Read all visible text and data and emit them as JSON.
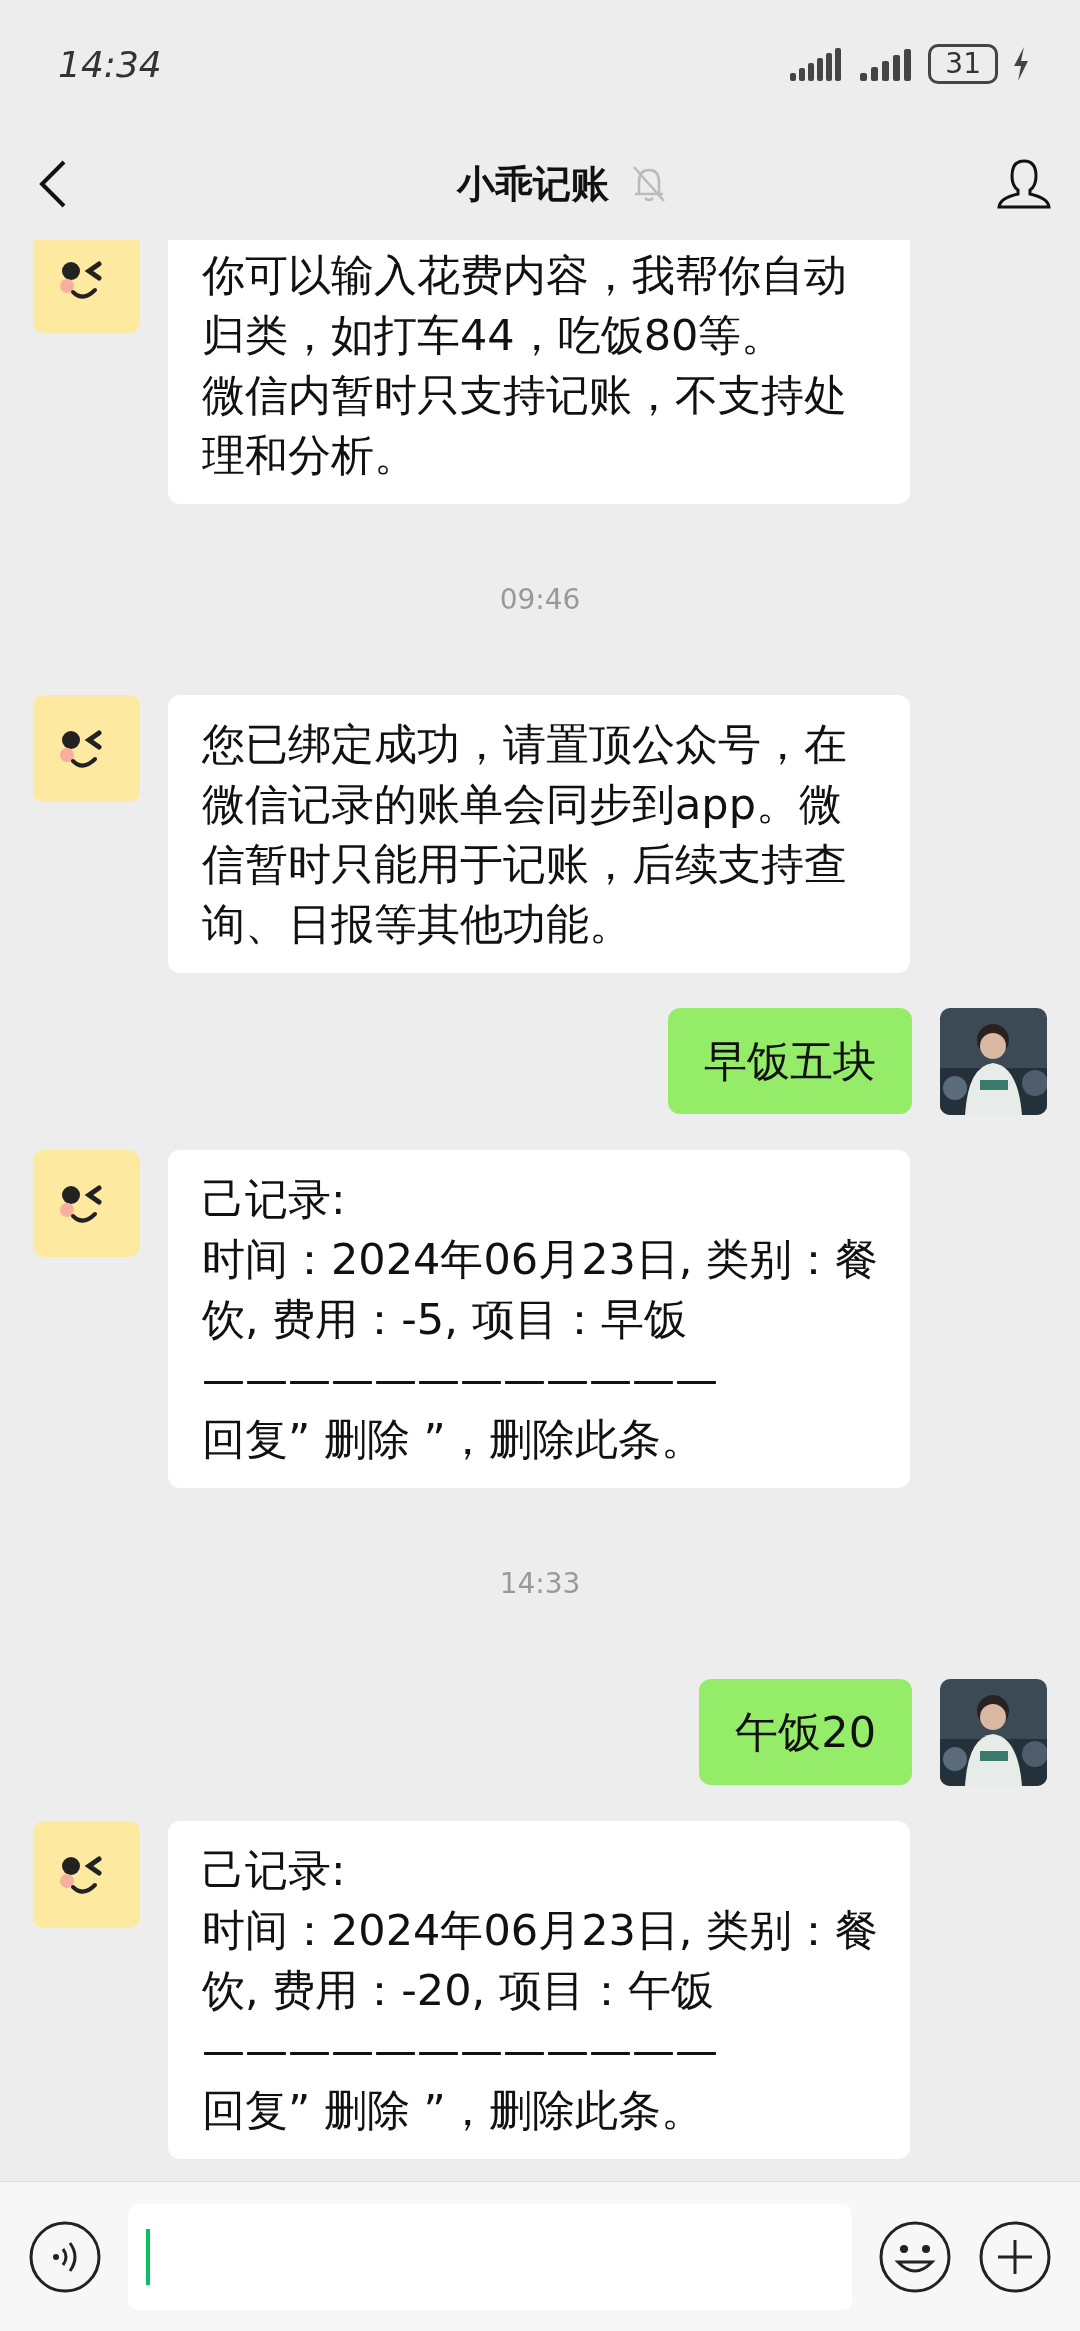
{
  "status_bar": {
    "time": "14:34",
    "battery": "31"
  },
  "header": {
    "title": "小乖记账",
    "muted": true
  },
  "messages": [
    {
      "kind": "received",
      "lines": [
        "你可以输入花费内容，我帮你自动归类，如打车44，吃饭80等。",
        "微信内暂时只支持记账，不支持处理和分析。"
      ]
    },
    {
      "kind": "time",
      "text": "09:46"
    },
    {
      "kind": "received",
      "lines": [
        "您已绑定成功，请置顶公众号，在微信记录的账单会同步到app。微信暂时只能用于记账，后续支持查询、日报等其他功能。"
      ]
    },
    {
      "kind": "sent",
      "text": "早饭五块"
    },
    {
      "kind": "received",
      "lines": [
        "己记录:",
        "时间：2024年06月23日, 类别：餐饮, 费用：-5, 项目：早饭",
        "————————————",
        "回复” 删除 ”，删除此条。"
      ]
    },
    {
      "kind": "time",
      "text": "14:33"
    },
    {
      "kind": "sent",
      "text": "午饭20"
    },
    {
      "kind": "received",
      "lines": [
        "己记录:",
        "时间：2024年06月23日, 类别：餐饮, 费用：-20, 项目：午饭",
        "————————————",
        "回复” 删除 ”，删除此条。"
      ]
    }
  ]
}
